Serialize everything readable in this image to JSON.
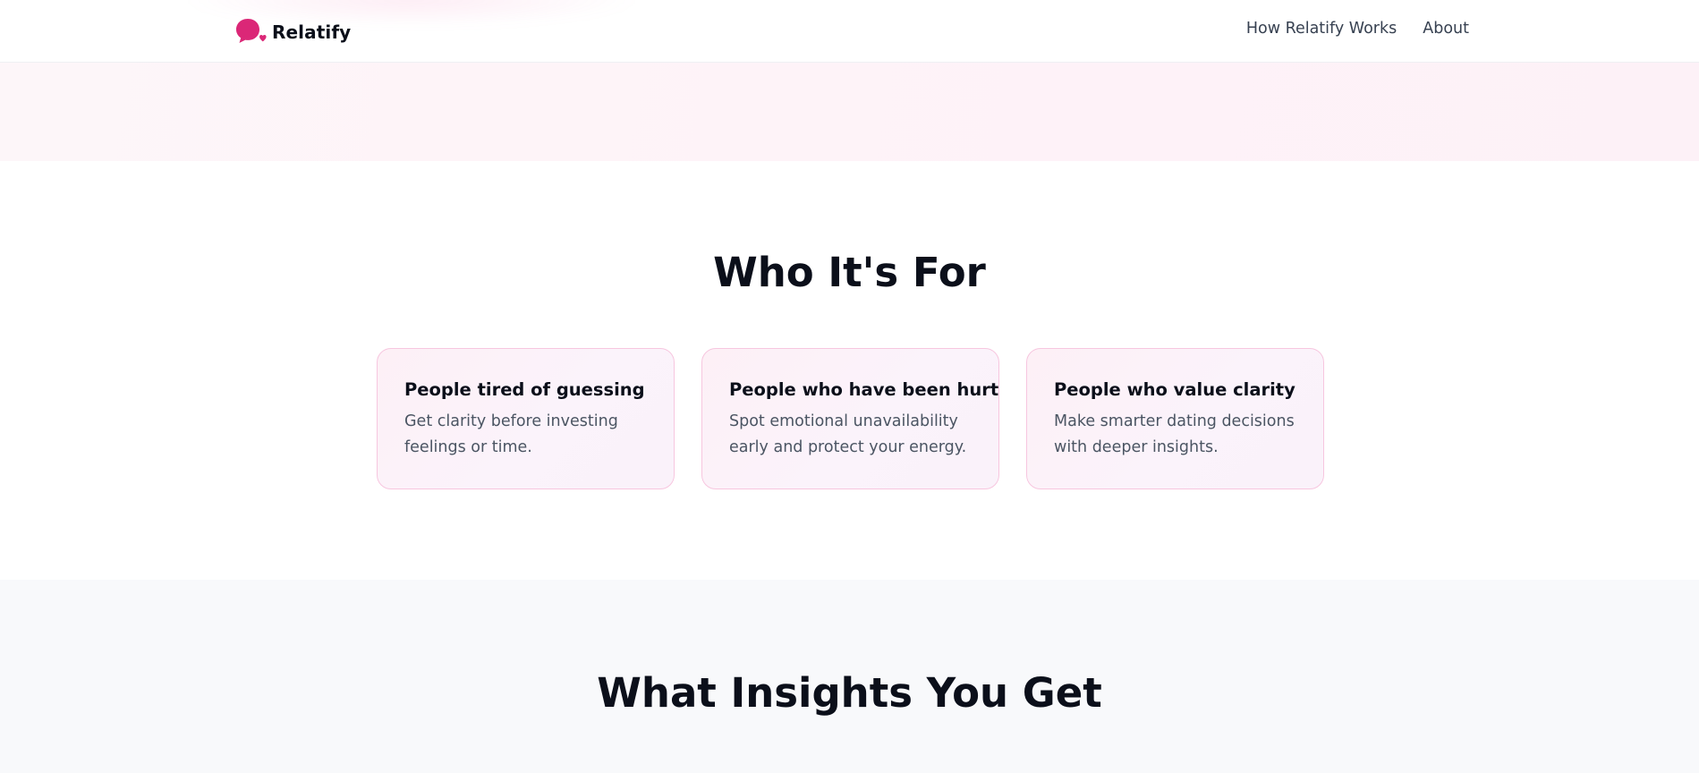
{
  "brand": {
    "name": "Relatify",
    "icon": "chat-heart-icon",
    "accent_color": "#db2777"
  },
  "nav": {
    "items": [
      {
        "label": "How Relatify Works"
      },
      {
        "label": "About"
      }
    ]
  },
  "who_section": {
    "title": "Who It's For",
    "cards": [
      {
        "title": "People tired of guessing",
        "description": "Get clarity before investing feelings or time."
      },
      {
        "title": "People who have been hurt",
        "description": "Spot emotional unavailability early and protect your energy."
      },
      {
        "title": "People who value clarity",
        "description": "Make smarter dating decisions with deeper insights."
      }
    ]
  },
  "insights_section": {
    "title": "What Insights You Get"
  }
}
